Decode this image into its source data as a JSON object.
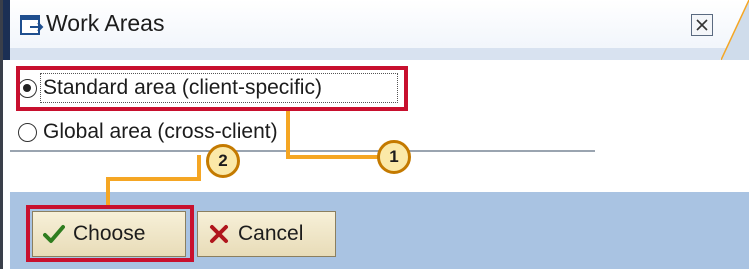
{
  "window": {
    "title": "Work Areas",
    "title_icon": "window-edit-icon",
    "close_icon": "close-x-icon"
  },
  "options": [
    {
      "label": "Standard area (client-specific)",
      "selected": true
    },
    {
      "label": "Global area (cross-client)",
      "selected": false
    }
  ],
  "buttons": {
    "choose": {
      "label": "Choose",
      "icon": "checkmark-icon"
    },
    "cancel": {
      "label": "Cancel",
      "icon": "cancel-x-icon"
    }
  },
  "callouts": [
    {
      "number": "1"
    },
    {
      "number": "2"
    }
  ],
  "colors": {
    "highlight": "#c8102e",
    "callout": "#f5a623",
    "footer": "#a9c3e2",
    "title_accent": "#1b2f54"
  }
}
